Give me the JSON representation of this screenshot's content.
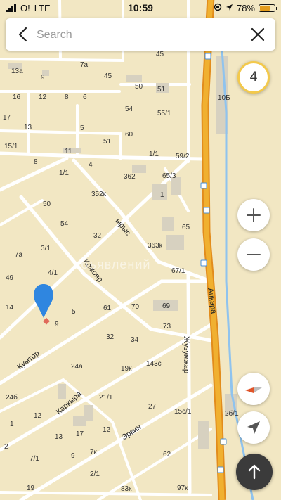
{
  "status_bar": {
    "carrier": "O!",
    "network": "LTE",
    "time": "10:59",
    "battery_percent": "78%",
    "battery_level": 0.78,
    "signal_bars": 4,
    "battery_color": "#e39b1b"
  },
  "search": {
    "placeholder": "Search"
  },
  "map_controls": {
    "zoom_level": "4"
  },
  "watermark": "объявлений",
  "map": {
    "colors": {
      "background": "#f2e7c3",
      "road": "#ffffff",
      "highway": "#f0b030",
      "highway_edge": "#e28c1c",
      "river": "#8fc3ee",
      "building": "#d7d1c0",
      "pin": "#2f86e0"
    },
    "streets": [
      "Кожояр",
      "Кумтор",
      "Каркыра",
      "Эркин",
      "Жузумжар",
      "Анкара",
      "ырыс"
    ],
    "numbers": [
      "45",
      "13a",
      "9",
      "7a",
      "45",
      "50",
      "51",
      "16",
      "12",
      "8",
      "6",
      "54",
      "55/1",
      "10Б",
      "17",
      "13",
      "5",
      "60",
      "15/1",
      "51",
      "11",
      "1/1",
      "59/2",
      "8",
      "4",
      "1/1",
      "362",
      "65/3",
      "352к",
      "1",
      "50",
      "54",
      "65",
      "32",
      "363к",
      "3/1",
      "7a",
      "4/1",
      "67/1",
      "49",
      "70",
      "61",
      "69",
      "14",
      "5",
      "9",
      "32",
      "34",
      "73",
      "24a",
      "19к",
      "143c",
      "24б",
      "21/1",
      "12",
      "2",
      "13",
      "17",
      "12",
      "27",
      "15c/1",
      "2б/1",
      "1",
      "7/1",
      "9",
      "7к",
      "62",
      "2/1",
      "19",
      "83к",
      "97к"
    ]
  }
}
